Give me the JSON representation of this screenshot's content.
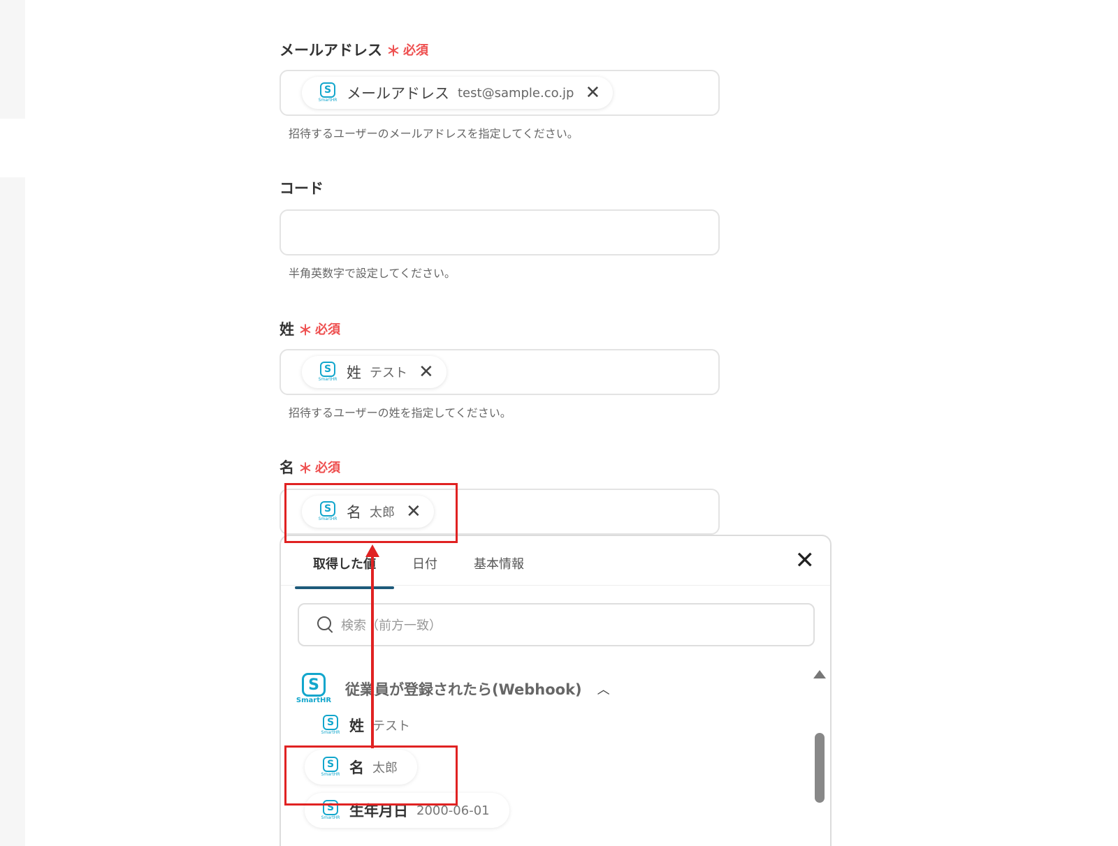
{
  "fields": [
    {
      "label": "メールアドレス",
      "required": "必須",
      "chip_label": "メールアドレス",
      "chip_value": "test@sample.co.jp",
      "hint": "招待するユーザーのメールアドレスを指定してください。"
    },
    {
      "label": "コード",
      "hint": "半角英数字で設定してください。"
    },
    {
      "label": "姓",
      "required": "必須",
      "chip_label": "姓",
      "chip_value": "テスト",
      "hint": "招待するユーザーの姓を指定してください。"
    },
    {
      "label": "名",
      "required": "必須",
      "chip_label": "名",
      "chip_value": "太郎"
    }
  ],
  "required_star": "＊",
  "close_glyph": "✕",
  "icon": {
    "glyph": "S",
    "brand": "SmartHR",
    "color": "#12a6cc"
  },
  "panel": {
    "tabs": [
      "取得した値",
      "日付",
      "基本情報"
    ],
    "search_placeholder": "検索（前方一致）",
    "group_title": "従業員が登録されたら(Webhook)",
    "group_caret": "︿",
    "items": [
      {
        "key": "姓",
        "value": "テスト"
      },
      {
        "key": "名",
        "value": "太郎"
      },
      {
        "key": "生年月日",
        "value": "2000-06-01"
      }
    ]
  },
  "colors": {
    "required": "#ee4f4f",
    "highlight": "#e02222",
    "tab_underline": "#1e5a7a"
  }
}
